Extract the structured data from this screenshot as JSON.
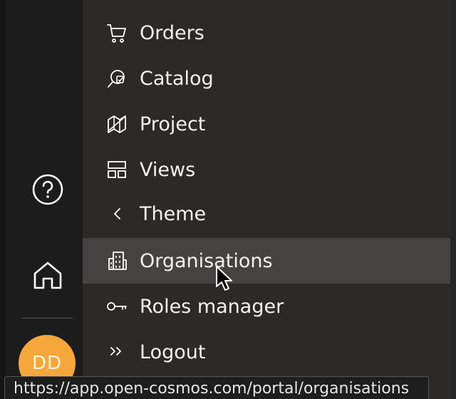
{
  "rail": {
    "help_icon": "help-circle-icon",
    "home_icon": "home-icon",
    "avatar_initials": "DD"
  },
  "menu": {
    "items": [
      {
        "label": "Orders",
        "icon": "cart-icon"
      },
      {
        "label": "Catalog",
        "icon": "catalog-search-icon"
      },
      {
        "label": "Project",
        "icon": "map-icon"
      },
      {
        "label": "Views",
        "icon": "layout-icon"
      },
      {
        "label": "Theme",
        "icon": "chevron-left-icon"
      },
      {
        "label": "Organisations",
        "icon": "building-icon",
        "active": true
      },
      {
        "label": "Roles manager",
        "icon": "key-icon"
      },
      {
        "label": "Logout",
        "icon": "double-chevron-right-icon"
      }
    ]
  },
  "status_bar": {
    "url": "https://app.open-cosmos.com/portal/organisations"
  },
  "colors": {
    "menu_bg": "#2b2a29",
    "active_bg": "#454342",
    "avatar": "#f5a73b"
  }
}
